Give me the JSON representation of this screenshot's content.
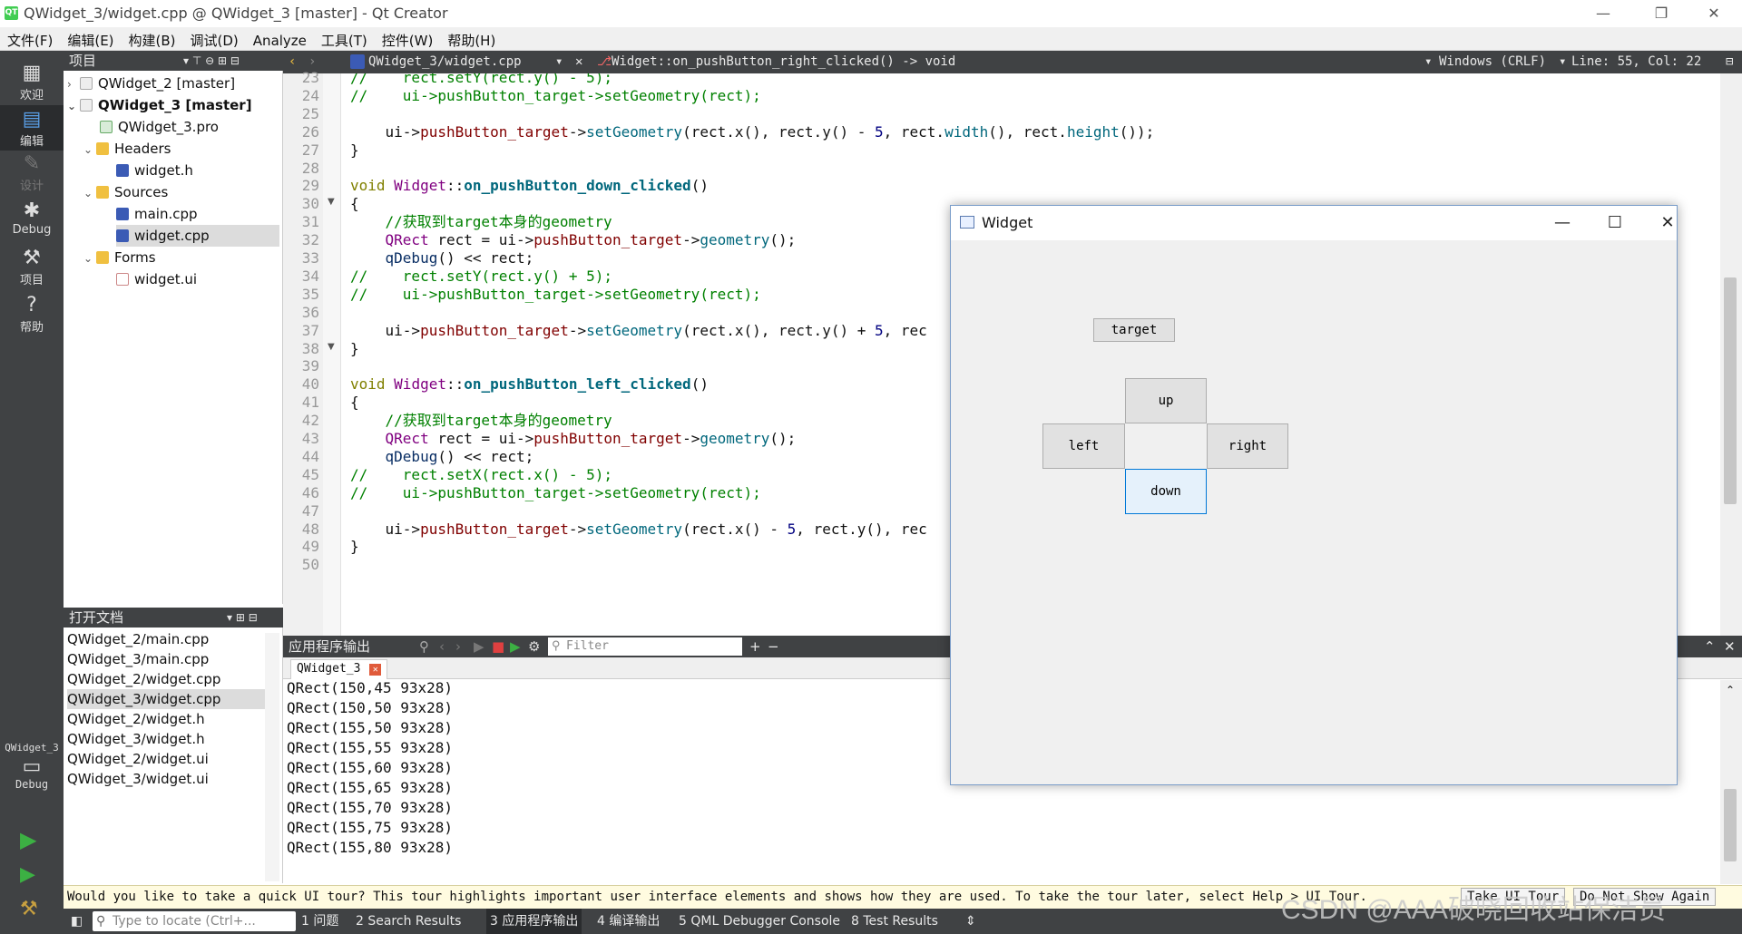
{
  "window": {
    "title": "QWidget_3/widget.cpp @ QWidget_3 [master] - Qt Creator",
    "app_icon": "QT",
    "min_glyph": "—",
    "max_glyph": "❐",
    "close_glyph": "✕"
  },
  "menu": [
    "文件(F)",
    "编辑(E)",
    "构建(B)",
    "调试(D)",
    "Analyze",
    "工具(T)",
    "控件(W)",
    "帮助(H)"
  ],
  "modes": [
    {
      "label": "欢迎",
      "icon": "grid-icon"
    },
    {
      "label": "编辑",
      "icon": "edit-icon"
    },
    {
      "label": "设计",
      "icon": "pencil-icon"
    },
    {
      "label": "Debug",
      "icon": "bug-icon"
    },
    {
      "label": "项目",
      "icon": "wrench-icon"
    },
    {
      "label": "帮助",
      "icon": "help-icon"
    }
  ],
  "kit": {
    "project": "QWidget_3",
    "config": "Debug"
  },
  "project_pane": {
    "title": "项目",
    "tree": [
      "QWidget_2 [master]",
      "QWidget_3 [master]",
      "QWidget_3.pro",
      "Headers",
      "widget.h",
      "Sources",
      "main.cpp",
      "widget.cpp",
      "Forms",
      "widget.ui"
    ]
  },
  "open_docs": {
    "title": "打开文档",
    "items": [
      "QWidget_2/main.cpp",
      "QWidget_3/main.cpp",
      "QWidget_2/widget.cpp",
      "QWidget_3/widget.cpp",
      "QWidget_2/widget.h",
      "QWidget_3/widget.h",
      "QWidget_2/widget.ui",
      "QWidget_3/widget.ui"
    ]
  },
  "editor": {
    "file": "QWidget_3/widget.cpp",
    "symbol": "Widget::on_pushButton_right_clicked() -> void",
    "line_ending": "Windows (CRLF)",
    "position": "Line: 55, Col: 22",
    "lines": [
      {
        "n": "23",
        "t": "//    rect.setY(rect.y() - 5);"
      },
      {
        "n": "24",
        "t": "//    ui->pushButton_target->setGeometry(rect);"
      },
      {
        "n": "25",
        "t": ""
      },
      {
        "n": "26",
        "t": "    ui->pushButton_target->setGeometry(rect.x(), rect.y() - 5, rect.width(), rect.height());"
      },
      {
        "n": "27",
        "t": "}"
      },
      {
        "n": "28",
        "t": ""
      },
      {
        "n": "29",
        "t": "void Widget::on_pushButton_down_clicked()"
      },
      {
        "n": "30",
        "t": "{"
      },
      {
        "n": "31",
        "t": "    //获取到target本身的geometry"
      },
      {
        "n": "32",
        "t": "    QRect rect = ui->pushButton_target->geometry();"
      },
      {
        "n": "33",
        "t": "    qDebug() << rect;"
      },
      {
        "n": "34",
        "t": "//    rect.setY(rect.y() + 5);"
      },
      {
        "n": "35",
        "t": "//    ui->pushButton_target->setGeometry(rect);"
      },
      {
        "n": "36",
        "t": ""
      },
      {
        "n": "37",
        "t": "    ui->pushButton_target->setGeometry(rect.x(), rect.y() + 5, rec"
      },
      {
        "n": "38",
        "t": "}"
      },
      {
        "n": "39",
        "t": ""
      },
      {
        "n": "40",
        "t": "void Widget::on_pushButton_left_clicked()"
      },
      {
        "n": "41",
        "t": "{"
      },
      {
        "n": "42",
        "t": "    //获取到target本身的geometry"
      },
      {
        "n": "43",
        "t": "    QRect rect = ui->pushButton_target->geometry();"
      },
      {
        "n": "44",
        "t": "    qDebug() << rect;"
      },
      {
        "n": "45",
        "t": "//    rect.setX(rect.x() - 5);"
      },
      {
        "n": "46",
        "t": "//    ui->pushButton_target->setGeometry(rect);"
      },
      {
        "n": "47",
        "t": ""
      },
      {
        "n": "48",
        "t": "    ui->pushButton_target->setGeometry(rect.x() - 5, rect.y(), rec"
      },
      {
        "n": "49",
        "t": "}"
      },
      {
        "n": "50",
        "t": ""
      }
    ]
  },
  "output_pane": {
    "title": "应用程序输出",
    "filter_placeholder": "Filter",
    "tab": "QWidget_3",
    "lines": [
      "QRect(150,45 93x28)",
      "QRect(150,50 93x28)",
      "QRect(155,50 93x28)",
      "QRect(155,55 93x28)",
      "QRect(155,60 93x28)",
      "QRect(155,65 93x28)",
      "QRect(155,70 93x28)",
      "QRect(155,75 93x28)",
      "QRect(155,80 93x28)"
    ]
  },
  "tour_bar": {
    "message": "Would you like to take a quick UI tour? This tour highlights important user interface elements and shows how they are used. To take the tour later, select Help > UI Tour.",
    "take_tour": "Take UI Tour",
    "dont_show": "Do Not Show Again"
  },
  "statusbar": {
    "locate_placeholder": "Type to locate (Ctrl+...",
    "tabs": [
      "1 问题",
      "2 Search Results",
      "3 应用程序输出",
      "4 编译输出",
      "5 QML Debugger Console",
      "8 Test Results"
    ]
  },
  "widget_window": {
    "title": "Widget",
    "buttons": {
      "target": "target",
      "up": "up",
      "left": "left",
      "right": "right",
      "down": "down"
    }
  },
  "watermark": "CSDN @AAA破晓回收站保洁员"
}
